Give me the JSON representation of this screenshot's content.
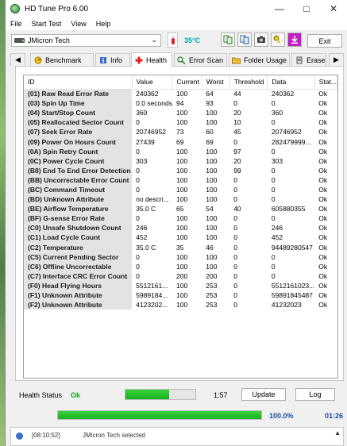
{
  "window": {
    "title": "HD Tune Pro 6.00"
  },
  "menu": [
    "File",
    "Start Test",
    "View",
    "Help"
  ],
  "toolbar": {
    "drive": "JMicron Tech",
    "temperature": "35°C",
    "exit": "Exit"
  },
  "tabs": [
    {
      "label": "Benchmark",
      "icon": "benchmark-icon"
    },
    {
      "label": "Info",
      "icon": "info-icon"
    },
    {
      "label": "Health",
      "icon": "health-cross-icon",
      "active": true
    },
    {
      "label": "Error Scan",
      "icon": "error-scan-icon"
    },
    {
      "label": "Folder Usage",
      "icon": "folder-icon"
    },
    {
      "label": "Erase",
      "icon": "erase-icon"
    }
  ],
  "table": {
    "columns": [
      "ID",
      "Value",
      "Current",
      "Worst",
      "Threshold",
      "Data",
      "Stat..."
    ],
    "rows": [
      [
        "(01) Raw Read Error Rate",
        "240362",
        "100",
        "64",
        "44",
        "240362",
        "Ok"
      ],
      [
        "(03) Spin Up Time",
        "0.0 seconds",
        "94",
        "93",
        "0",
        "0",
        "Ok"
      ],
      [
        "(04) Start/Stop Count",
        "360",
        "100",
        "100",
        "20",
        "360",
        "Ok"
      ],
      [
        "(05) Reallocated Sector Count",
        "0",
        "100",
        "100",
        "10",
        "0",
        "Ok"
      ],
      [
        "(07) Seek Error Rate",
        "20746952",
        "73",
        "60",
        "45",
        "20746952",
        "Ok"
      ],
      [
        "(09) Power On Hours Count",
        "27439",
        "69",
        "69",
        "0",
        "282479999...",
        "Ok"
      ],
      [
        "(0A) Spin Retry Count",
        "0",
        "100",
        "100",
        "97",
        "0",
        "Ok"
      ],
      [
        "(0C) Power Cycle Count",
        "303",
        "100",
        "100",
        "20",
        "303",
        "Ok"
      ],
      [
        "(B8) End To End Error Detection",
        "0",
        "100",
        "100",
        "99",
        "0",
        "Ok"
      ],
      [
        "(BB) Uncorrectable Error Count",
        "0",
        "100",
        "100",
        "0",
        "0",
        "Ok"
      ],
      [
        "(BC) Command Timeout",
        "0",
        "100",
        "100",
        "0",
        "0",
        "Ok"
      ],
      [
        "(BD) Unknown Attribute",
        "no descri...",
        "100",
        "100",
        "0",
        "0",
        "Ok"
      ],
      [
        "(BE) Airflow Temperature",
        "35.0 C",
        "65",
        "54",
        "40",
        "605880355",
        "Ok"
      ],
      [
        "(BF) G-sense Error Rate",
        "0",
        "100",
        "100",
        "0",
        "0",
        "Ok"
      ],
      [
        "(C0) Unsafe Shutdown Count",
        "246",
        "100",
        "100",
        "0",
        "246",
        "Ok"
      ],
      [
        "(C1) Load Cycle Count",
        "452",
        "100",
        "100",
        "0",
        "452",
        "Ok"
      ],
      [
        "(C2) Temperature",
        "35.0 C",
        "35",
        "46",
        "0",
        "94489280547",
        "Ok"
      ],
      [
        "(C5) Current Pending Sector",
        "0",
        "100",
        "100",
        "0",
        "0",
        "Ok"
      ],
      [
        "(C6) Offline Uncorrectable",
        "0",
        "100",
        "100",
        "0",
        "0",
        "Ok"
      ],
      [
        "(C7) Interface CRC Error Count",
        "0",
        "200",
        "200",
        "0",
        "0",
        "Ok"
      ],
      [
        "(F0) Head Flying Hours",
        "5512161...",
        "100",
        "253",
        "0",
        "5512161023...",
        "Ok"
      ],
      [
        "(F1) Unknown Attribute",
        "5989184...",
        "100",
        "253",
        "0",
        "59891845487",
        "Ok"
      ],
      [
        "(F2) Unknown Attribute",
        "4123202...",
        "100",
        "253",
        "0",
        "41232023",
        "Ok"
      ]
    ]
  },
  "status": {
    "health_label": "Health Status",
    "health_value": "Ok",
    "progress": 0.62,
    "time": "1:57",
    "update": "Update",
    "log": "Log"
  },
  "total": {
    "percent": "100.0%",
    "progress": 1.0,
    "time": "01:26"
  },
  "log": {
    "time": "[08:10:52]",
    "message": "JMicron Tech selected"
  },
  "colors": {
    "ok": "#18a018",
    "progress": "#17b01f",
    "accent": "#1a4f9e",
    "temp": "#00aaaa"
  }
}
